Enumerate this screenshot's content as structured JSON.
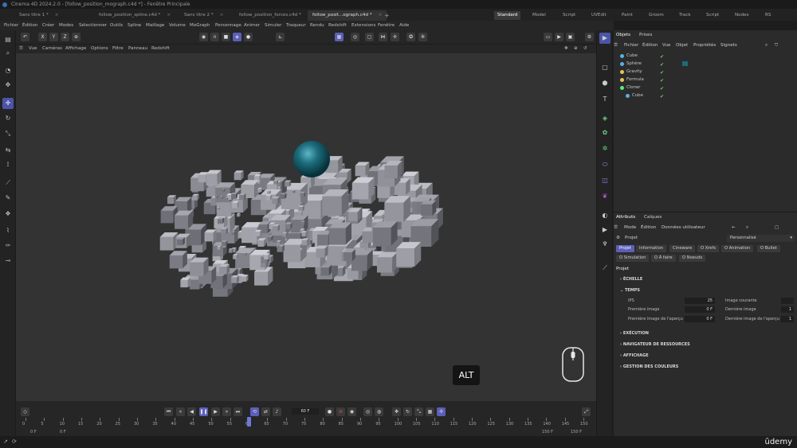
{
  "window": {
    "title": "Cinema 4D 2024.2.0 - [follow_position_mograph.c4d *] - Fenêtre Principale"
  },
  "doc_tabs": [
    {
      "label": "Sans titre 1 *",
      "active": false
    },
    {
      "label": "follow_position_spline.c4d *",
      "active": false
    },
    {
      "label": "Sans titre 2 *",
      "active": false
    },
    {
      "label": "follow_position_forces.c4d *",
      "active": false
    },
    {
      "label": "follow_posit...ograph.c4d *",
      "active": true
    }
  ],
  "add_tab_label": "+",
  "layouts": [
    {
      "label": "Standard",
      "active": true
    },
    {
      "label": "Model",
      "active": false
    },
    {
      "label": "Script",
      "active": false
    },
    {
      "label": "UVEdit",
      "active": false
    },
    {
      "label": "Paint",
      "active": false
    },
    {
      "label": "Groom",
      "active": false
    },
    {
      "label": "Track",
      "active": false
    },
    {
      "label": "Script",
      "active": false
    },
    {
      "label": "Nodes",
      "active": false
    },
    {
      "label": "RS",
      "active": false
    }
  ],
  "main_menu": [
    "Fichier",
    "Édition",
    "Créer",
    "Modes",
    "Sélectionner",
    "Outils",
    "Spline",
    "Maillage",
    "Volume",
    "MoGraph",
    "Personnage",
    "Animer",
    "Simuler",
    "Traqueur",
    "Rendu",
    "Redshift",
    "Extensions",
    "Fenêtre",
    "Aide"
  ],
  "toolbar": {
    "axis_x": "X",
    "axis_y": "Y",
    "axis_z": "Z"
  },
  "viewport_menu": [
    "Vue",
    "Caméras",
    "Affichage",
    "Options",
    "Filtre",
    "Panneau",
    "Redshift"
  ],
  "viewport": {
    "alt_label": "ALT"
  },
  "object_panel": {
    "tabs": [
      {
        "label": "Objets",
        "active": true
      },
      {
        "label": "Prises",
        "active": false
      }
    ],
    "menu": [
      "Fichier",
      "Édition",
      "Vue",
      "Objet",
      "Propriétés",
      "Signets"
    ],
    "objects": [
      {
        "name": "Cube",
        "indent": 0,
        "color": "#5ab0e8"
      },
      {
        "name": "Sphère",
        "indent": 0,
        "color": "#5ab0e8"
      },
      {
        "name": "Gravity",
        "indent": 0,
        "color": "#e8c35a"
      },
      {
        "name": "Formula",
        "indent": 0,
        "color": "#e8c35a"
      },
      {
        "name": "Cloner",
        "indent": 0,
        "color": "#5ae88b"
      },
      {
        "name": "Cube",
        "indent": 1,
        "color": "#5ab0e8"
      }
    ]
  },
  "attributes": {
    "tabs": [
      {
        "label": "Attributs",
        "active": true
      },
      {
        "label": "Calques",
        "active": false
      }
    ],
    "menu": [
      "Mode",
      "Édition",
      "Données utilisateur"
    ],
    "object_label": "Projet",
    "preset": "Personnalisé",
    "chips_row1": [
      {
        "label": "Projet",
        "active": true
      },
      {
        "label": "Information",
        "active": false
      },
      {
        "label": "Cineware",
        "active": false
      },
      {
        "label": "O Xrefs",
        "active": false
      },
      {
        "label": "O Animation",
        "active": false
      },
      {
        "label": "O Bullet",
        "active": false
      }
    ],
    "chips_row2": [
      {
        "label": "O Simulation",
        "active": false
      },
      {
        "label": "O À faire",
        "active": false
      },
      {
        "label": "O Noeuds",
        "active": false
      }
    ],
    "section_title": "Projet",
    "sections": {
      "echelle": "ÉCHELLE",
      "temps": "TEMPS",
      "execution": "EXÉCUTION",
      "navigateur": "NAVIGATEUR DE RESSOURCES",
      "affichage": "AFFICHAGE",
      "couleurs": "GESTION DES COULEURS"
    },
    "fields": {
      "ips_label": "IPS",
      "ips_value": "25",
      "premiere_label": "Première image",
      "premiere_value": "0 F",
      "premiere_apercu_label": "Première image de l'aperçu",
      "premiere_apercu_value": "0 F",
      "courante_label": "Image courante",
      "derniere_label": "Dernière image",
      "derniere_apercu_label": "Dernière image de l'aperçu",
      "right_value_1": "1",
      "right_value_2": "1"
    }
  },
  "timeline": {
    "current_frame": "60 F",
    "ticks": [
      "0",
      "5",
      "10",
      "15",
      "20",
      "25",
      "30",
      "35",
      "40",
      "45",
      "50",
      "55",
      "60",
      "65",
      "70",
      "75",
      "80",
      "85",
      "90",
      "95",
      "100",
      "105",
      "110",
      "115",
      "120",
      "125",
      "130",
      "135",
      "140",
      "145",
      "150"
    ],
    "start_left": "0 F",
    "start_right": "0 F",
    "end_left": "150 F",
    "end_right": "150 F"
  },
  "branding": {
    "udemy": "ūdemy"
  }
}
